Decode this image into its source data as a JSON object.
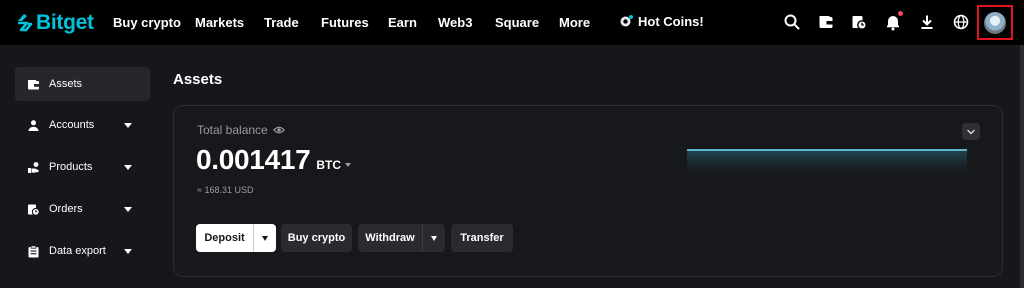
{
  "header": {
    "brand": "Bitget",
    "brand_color": "#00c4dc",
    "nav": [
      {
        "label": "Buy crypto"
      },
      {
        "label": "Markets"
      },
      {
        "label": "Trade"
      },
      {
        "label": "Futures"
      },
      {
        "label": "Earn"
      },
      {
        "label": "Web3"
      },
      {
        "label": "Square"
      },
      {
        "label": "More"
      }
    ],
    "hot_coins": "Hot Coins!",
    "icons": [
      "search-icon",
      "wallet-icon",
      "orders-icon",
      "bell-icon",
      "download-icon",
      "globe-icon",
      "avatar"
    ]
  },
  "sidebar": {
    "items": [
      {
        "label": "Assets",
        "icon": "wallet-icon",
        "active": true
      },
      {
        "label": "Accounts",
        "icon": "person-icon"
      },
      {
        "label": "Products",
        "icon": "products-icon"
      },
      {
        "label": "Orders",
        "icon": "orders-icon"
      },
      {
        "label": "Data export",
        "icon": "clipboard-icon"
      }
    ]
  },
  "main": {
    "title": "Assets",
    "balance_card": {
      "label": "Total balance",
      "value": "0.001417",
      "unit": "BTC",
      "approx": "≈ 168.31 USD",
      "buttons": {
        "deposit": "Deposit",
        "buy_crypto": "Buy crypto",
        "withdraw": "Withdraw",
        "transfer": "Transfer"
      }
    }
  },
  "colors": {
    "background": "#16171a",
    "topbar": "#000000",
    "accent": "#00c4dc",
    "alert": "#f6465d"
  }
}
